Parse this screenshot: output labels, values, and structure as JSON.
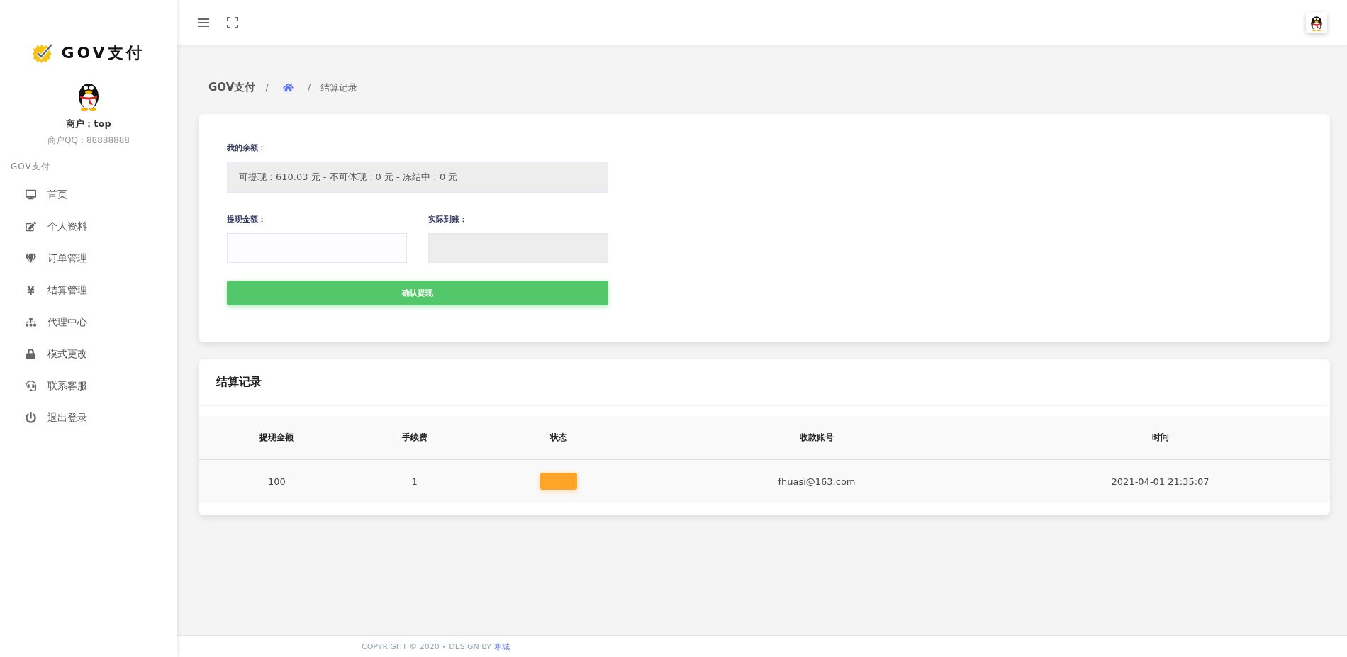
{
  "sidebar": {
    "logo_text": "GOV支付",
    "merchant": "商户：top",
    "merchant_qq": "商户QQ：88888888",
    "section_label": "GOV支付",
    "items": [
      {
        "label": "首页",
        "selected": false
      },
      {
        "label": "个人资料",
        "selected": false
      },
      {
        "label": "订单管理",
        "selected": false
      },
      {
        "label": "结算管理",
        "selected": false
      },
      {
        "label": "代理中心",
        "selected": false
      },
      {
        "label": "模式更改",
        "selected": false
      },
      {
        "label": "联系客服",
        "selected": false
      },
      {
        "label": "退出登录",
        "selected": false
      }
    ]
  },
  "breadcrumb": {
    "root": "GOV支付",
    "separator": "/",
    "current": "结算记录"
  },
  "withdraw_form": {
    "balance_label": "我的余额：",
    "balance_value": "可提现：610.03 元 - 不可体现：0 元 - 冻结中：0 元",
    "amount_label": "提现金额：",
    "received_label": "实际到账：",
    "submit": "确认提现"
  },
  "records": {
    "title": "结算记录",
    "columns": [
      "提现金额",
      "手续费",
      "状态",
      "收款账号",
      "时间"
    ],
    "rows": [
      {
        "amount": "100",
        "fee": "1",
        "account": "fhuasi@163.com",
        "time": "2021-04-01 21:35:07"
      }
    ]
  },
  "footer": {
    "text": "COPYRIGHT © 2020 • DESIGN BY",
    "link": "寒城"
  }
}
